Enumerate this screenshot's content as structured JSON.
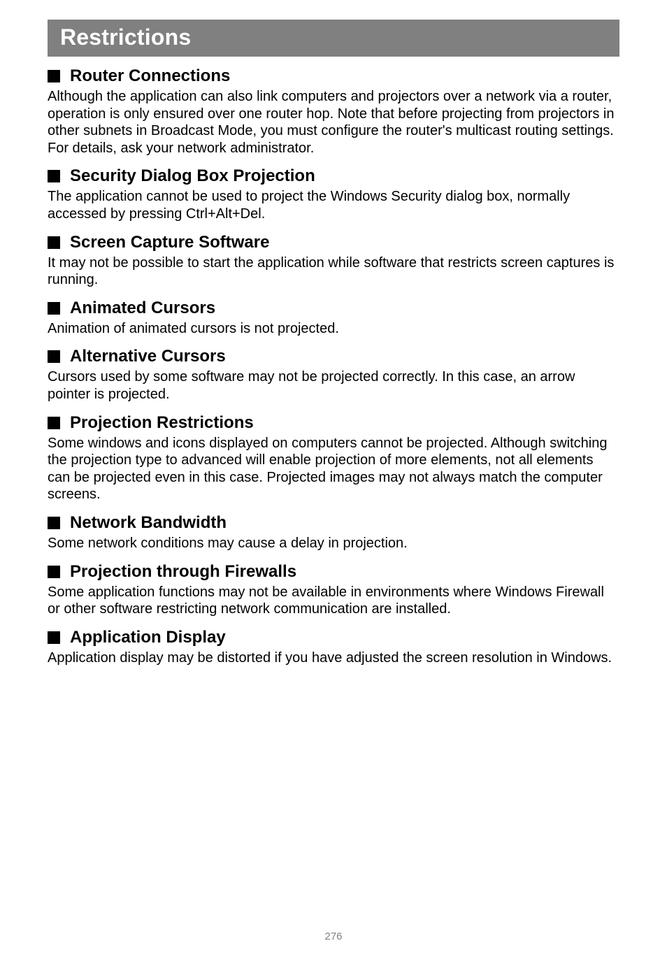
{
  "page_title": "Restrictions",
  "sections": [
    {
      "heading": "Router Connections",
      "body": "Although the application can also link computers and projectors over a network via a router, operation is only ensured over one router hop. Note that before projecting from projectors in other subnets in Broadcast Mode, you must configure the router's multicast routing settings. For details, ask your network administrator."
    },
    {
      "heading": "Security Dialog Box Projection",
      "body": "The application cannot be used to project the Windows Security dialog box, normally accessed by pressing Ctrl+Alt+Del."
    },
    {
      "heading": "Screen Capture Software",
      "body": "It may not be possible to start the application while software that restricts screen captures is running."
    },
    {
      "heading": "Animated Cursors",
      "body": "Animation of animated cursors is not projected."
    },
    {
      "heading": "Alternative Cursors",
      "body": "Cursors used by some software may not be projected correctly. In this case, an arrow pointer is projected."
    },
    {
      "heading": "Projection Restrictions",
      "body": "Some windows and icons displayed on computers cannot be projected. Although switching the projection type to advanced will enable projection of more elements, not all elements can be projected even in this case.\nProjected images may not always match the computer screens."
    },
    {
      "heading": "Network Bandwidth",
      "body": "Some network conditions may cause a delay in projection."
    },
    {
      "heading": "Projection through Firewalls",
      "body": "Some application functions may not be available in environments where Windows Firewall or other software restricting network communication are installed."
    },
    {
      "heading": "Application Display",
      "body": "Application display may be distorted if you have adjusted the screen resolution in Windows."
    }
  ],
  "page_number": "276"
}
